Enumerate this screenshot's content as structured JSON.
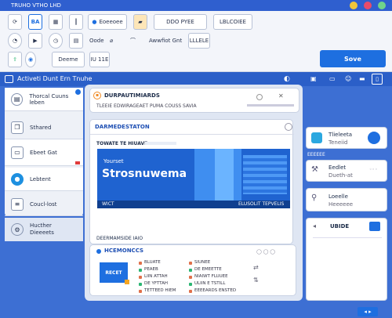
{
  "window": {
    "title": "TRUHO VTHO LHD"
  },
  "ribbon": {
    "row1": {
      "ba": "BA",
      "item2": "Eoeeoee",
      "item3": "DDO PYEE",
      "item4": "LBLCOIEE"
    },
    "row2": {
      "item1": "Oode",
      "item2": "Awwfiot Gnt",
      "item3": "LLLELE"
    },
    "row3": {
      "item1": "Deeme",
      "item2": "IU 11E"
    },
    "primary_label": "Sove"
  },
  "app": {
    "title": "Activeti Dunt Ern Tnuhe"
  },
  "sidebar": {
    "items": [
      {
        "label": "Thorcal Cuuns leben",
        "icon": "document-icon"
      },
      {
        "label": "Sthared",
        "icon": "copy-icon"
      },
      {
        "label": "Ebeet Gat",
        "icon": "tag-icon"
      },
      {
        "label": "Lebtent",
        "icon": "circle-icon"
      },
      {
        "label": "Coucl-lost",
        "icon": "list-icon"
      },
      {
        "label": "Hucther Dieeeets",
        "icon": "settings-icon"
      }
    ]
  },
  "doc": {
    "title": "DURPAUTIMIARDS",
    "subtitle": "TLEEIE EDWIRAGEAET PUMA COUSS SAVIA"
  },
  "editor": {
    "heading": "DARMEDESTATON",
    "subheading": "TOWATE TE HIUAVE",
    "banner_small": "Yourset",
    "banner_title": "Strosnuwema",
    "banner_footer_left": "WICT",
    "banner_footer_right": "ELUSOLIT TEPVELIS",
    "footer": "DEERMAMSIDE IAIO"
  },
  "bottom": {
    "heading": "HCEMONCCS",
    "button": "RECET",
    "col1": [
      "BLUATE",
      "PEAEB",
      "LIIN ATTAH",
      "DE YFTTAH",
      "TETTEED HIEM"
    ],
    "col2": [
      "SIUNEE",
      "DE EMEETTE",
      "NIAIWT FLUUEE",
      "ULIIN E TSTILL",
      "EEEEARDS ENSTED"
    ]
  },
  "right": {
    "card1": {
      "title": "Tlieleeta",
      "subtitle": "Teneiid"
    },
    "card2": {
      "header": "EEEEEE",
      "title": "Eedlet",
      "subtitle": "Dueth-at"
    },
    "card3": {
      "title": "Loeelle",
      "subtitle": "Heeeeee"
    },
    "card4": {
      "title": "UBIDE"
    }
  },
  "colors": {
    "accent": "#1e6fe0",
    "header": "#2b5fc8",
    "page": "#3d6fd3",
    "badge": "#f6a623"
  }
}
